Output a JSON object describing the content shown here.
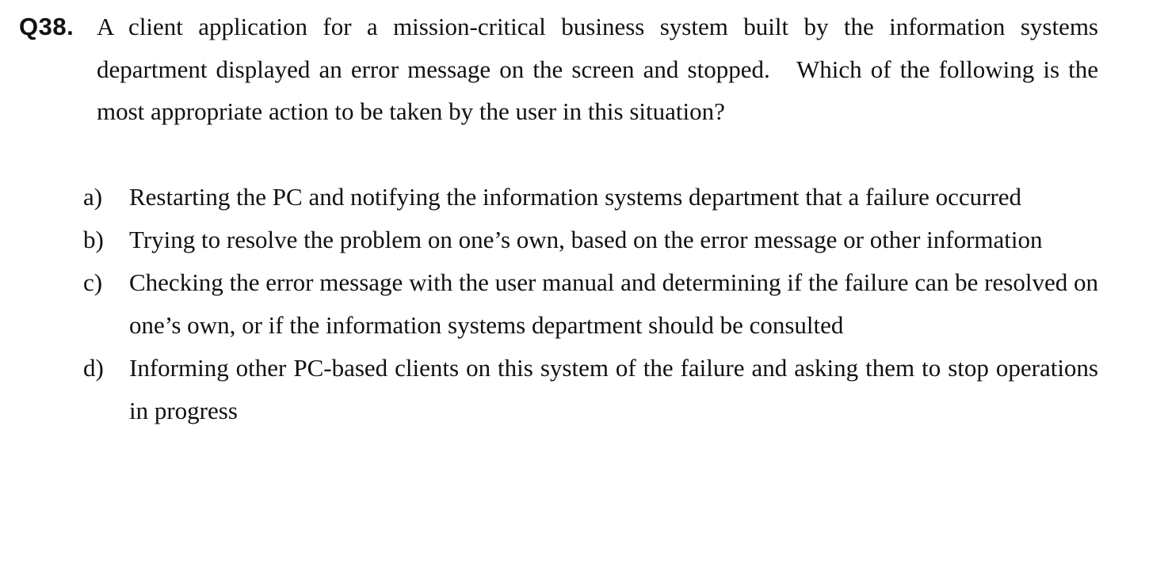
{
  "question": {
    "number": "Q38.",
    "text": "A client application for a mission-critical business system built by the information systems department displayed an error message on the screen and stopped.   Which of the following is the most appropriate action to be taken by the user in this situation?"
  },
  "options": [
    {
      "letter": "a)",
      "text": "Restarting the PC and notifying the information systems department that a failure occurred"
    },
    {
      "letter": "b)",
      "text": "Trying to resolve the problem on one’s own, based on the error message or other information"
    },
    {
      "letter": "c)",
      "text": "Checking the error message with the user manual and determining if the failure can be resolved on one’s own, or if the information systems department should be consulted"
    },
    {
      "letter": "d)",
      "text": "Informing other PC-based clients on this system of the failure and asking them to stop operations in progress"
    }
  ]
}
